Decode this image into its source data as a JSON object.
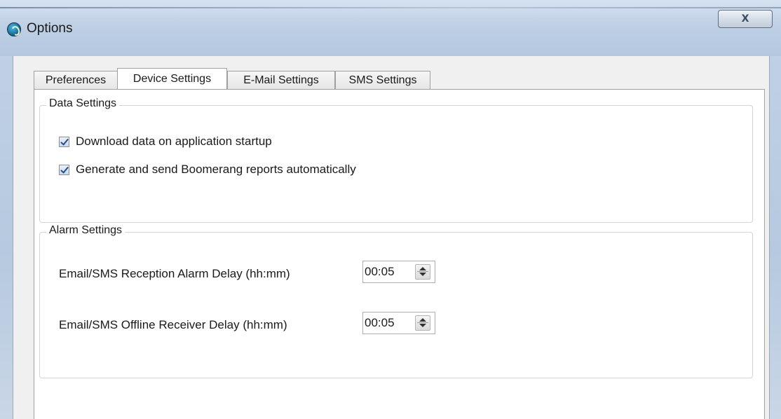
{
  "window": {
    "title": "Options",
    "close_glyph": "X"
  },
  "tabs": [
    {
      "label": "Preferences",
      "active": false
    },
    {
      "label": "Device Settings",
      "active": true
    },
    {
      "label": "E-Mail Settings",
      "active": false
    },
    {
      "label": "SMS Settings",
      "active": false
    }
  ],
  "data_settings": {
    "legend": "Data Settings",
    "checkboxes": [
      {
        "label": "Download data on application startup",
        "checked": true
      },
      {
        "label": "Generate and send Boomerang reports automatically",
        "checked": true
      }
    ]
  },
  "alarm_settings": {
    "legend": "Alarm Settings",
    "fields": [
      {
        "label": "Email/SMS Reception Alarm Delay (hh:mm)",
        "value": "00:05"
      },
      {
        "label": "Email/SMS Offline Receiver Delay (hh:mm)",
        "value": "00:05"
      }
    ]
  },
  "icons": {
    "app": "app-logo-icon",
    "close": "close-icon",
    "spin": "spin-updown-icon"
  }
}
